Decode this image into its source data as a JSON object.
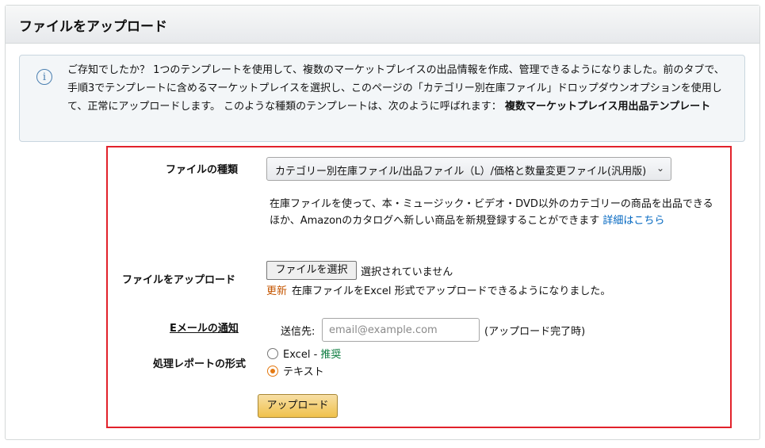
{
  "panel": {
    "title": "ファイルをアップロード"
  },
  "info": {
    "text": "ご存知でしたか？ 1つのテンプレートを使用して、複数のマーケットプレイスの出品情報を作成、管理できるようになりました。前のタブで、手順3でテンプレートに含めるマーケットプレイスを選択し、このページの「カテゴリー別在庫ファイル」ドロップダウンオプションを使用して、正常にアップロードします。 このような種類のテンプレートは、次のように呼ばれます：",
    "bold_text": "複数マーケットプレイス用出品テンプレート"
  },
  "form": {
    "file_type_label": "ファイルの種類",
    "file_type_selected": "カテゴリー別在庫ファイル/出品ファイル（L）/価格と数量変更ファイル(汎用版)",
    "description": "在庫ファイルを使って、本・ミュージック・ビデオ・DVD以外のカテゴリーの商品を出品できるほか、Amazonのカタログへ新しい商品を新規登録することができます",
    "details_link": "詳細はこちら",
    "upload_label": "ファイルをアップロード",
    "choose_file_button": "ファイルを選択",
    "no_file_text": "選択されていません",
    "update_badge": "更新",
    "update_text": "在庫ファイルをExcel 形式でアップロードできるようになりました。",
    "email_label": "Eメールの通知",
    "email_to_label": "送信先:",
    "email_placeholder": "email@example.com",
    "email_after": "(アップロード完了時)",
    "report_label": "処理レポートの形式",
    "report_option_excel": "Excel - ",
    "report_option_excel_rec": "推奨",
    "report_option_text": "テキスト",
    "report_selected": "テキスト",
    "upload_button": "アップロード"
  },
  "colors": {
    "highlight_border": "#e2222b",
    "link": "#0066c0",
    "update": "#c45500",
    "recommended": "#0a7b3e",
    "radio_checked": "#e47911"
  }
}
